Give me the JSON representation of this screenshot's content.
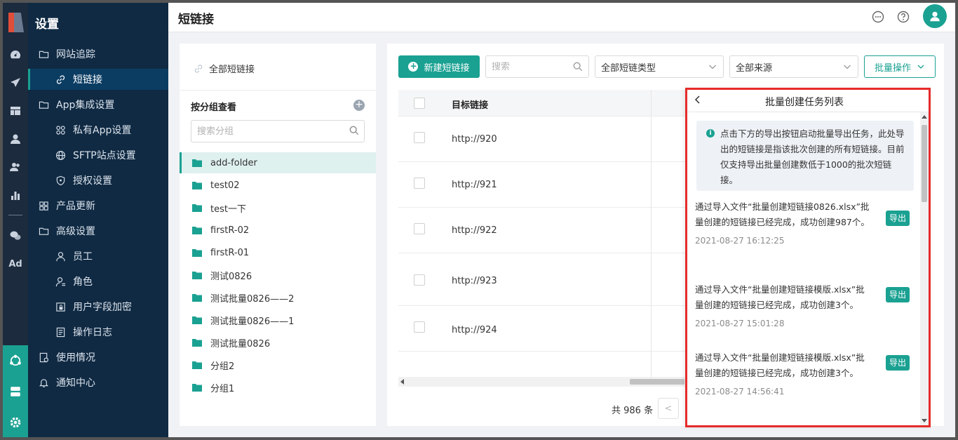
{
  "nav": {
    "title": "设置",
    "items": [
      {
        "label": "网站追踪",
        "icon": "folder-icon"
      },
      {
        "label": "短链接",
        "icon": "link-icon"
      },
      {
        "label": "App集成设置",
        "icon": "folder-icon"
      },
      {
        "label": "私有App设置",
        "icon": "apps-icon"
      },
      {
        "label": "SFTP站点设置",
        "icon": "globe-icon"
      },
      {
        "label": "授权设置",
        "icon": "shield-icon"
      },
      {
        "label": "产品更新",
        "icon": "grid-icon"
      },
      {
        "label": "高级设置",
        "icon": "folder-icon"
      },
      {
        "label": "员工",
        "icon": "user-icon"
      },
      {
        "label": "角色",
        "icon": "role-icon"
      },
      {
        "label": "用户字段加密",
        "icon": "encrypt-icon"
      },
      {
        "label": "操作日志",
        "icon": "log-icon"
      },
      {
        "label": "使用情况",
        "icon": "usage-icon"
      },
      {
        "label": "通知中心",
        "icon": "bell-icon"
      }
    ]
  },
  "rail": {
    "ad_label": "Ad"
  },
  "topbar": {
    "page_title": "短链接"
  },
  "groups": {
    "all_label": "全部短链接",
    "header": "按分组查看",
    "add_symbol": "+",
    "search_placeholder": "搜索分组",
    "folders": [
      "add-folder",
      "test02",
      "test一下",
      "firstR-02",
      "firstR-01",
      "测试0826",
      "测试批量0826——2",
      "测试批量0826——1",
      "测试批量0826",
      "分组2",
      "分组1"
    ]
  },
  "toolbar": {
    "new_label": "新建短链接",
    "search_placeholder": "搜索",
    "type_select": "全部短链类型",
    "source_select": "全部来源",
    "batch_label": "批量操作"
  },
  "table": {
    "header_target": "目标链接",
    "rows": [
      "http://920",
      "http://921",
      "http://922",
      "http://923",
      "http://924"
    ]
  },
  "footer": {
    "total": "共 986 条",
    "prev_symbol": "<"
  },
  "drawer": {
    "title": "批量创建任务列表",
    "notice": "点击下方的导出按钮启动批量导出任务，此处导出的短链接是指该批次创建的所有短链接。目前仅支持导出批量创建数低于1000的批次短链接。",
    "export_label": "导出",
    "tasks": [
      {
        "text": "通过导入文件“批量创建短链接0826.xlsx”批量创建的短链接已经完成，成功创建987个。",
        "time": "2021-08-27 16:12:25"
      },
      {
        "text": "通过导入文件“批量创建短链接模版.xlsx”批量创建的短链接已经完成，成功创建3个。",
        "time": "2021-08-27 15:01:28"
      },
      {
        "text": "通过导入文件“批量创建短链接模版.xlsx”批量创建的短链接已经完成，成功创建3个。",
        "time": "2021-08-27 14:56:41"
      }
    ]
  },
  "colors": {
    "accent": "#1aa192",
    "sidebar": "#102a43",
    "highlight_border": "#e62b2b"
  }
}
